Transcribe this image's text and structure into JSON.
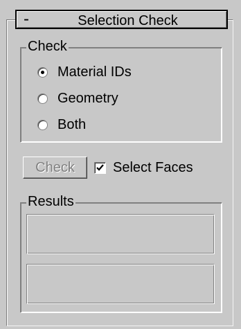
{
  "rollout": {
    "collapse_symbol": "-",
    "title": "Selection Check"
  },
  "check_group": {
    "legend": "Check",
    "options": [
      {
        "label": "Material IDs",
        "selected": true
      },
      {
        "label": "Geometry",
        "selected": false
      },
      {
        "label": "Both",
        "selected": false
      }
    ]
  },
  "actions": {
    "check_button_label": "Check",
    "check_button_enabled": false,
    "select_faces_label": "Select Faces",
    "select_faces_checked": true
  },
  "results_group": {
    "legend": "Results",
    "field_1": "",
    "field_2": ""
  },
  "icons": {
    "collapse": "minus-icon",
    "checkmark": "checkmark-icon"
  },
  "colors": {
    "panel_background": "#c8c8c8",
    "disabled_text": "#808080",
    "header_border": "#000000"
  }
}
